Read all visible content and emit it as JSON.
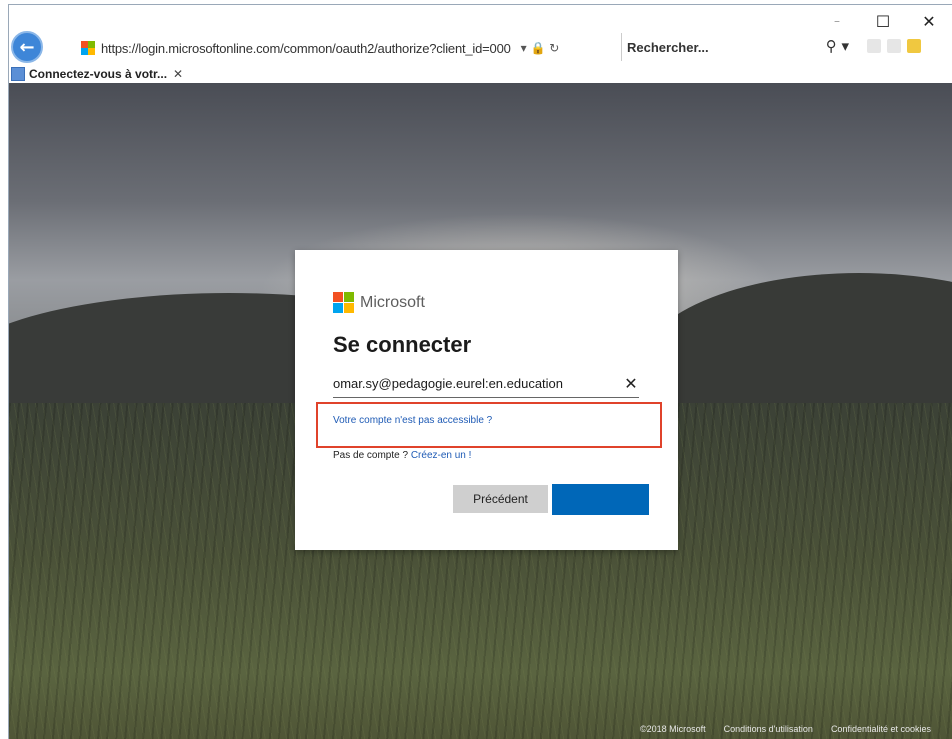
{
  "window": {
    "minimize_glyph": "–",
    "maximize_glyph": "☐",
    "close_glyph": "✕"
  },
  "browser": {
    "back_glyph": "←",
    "url": "https://login.microsoftonline.com/common/oauth2/authorize?client_id=000",
    "url_icons": "▾ 🔒 ↻",
    "search_placeholder": "Rechercher...",
    "search_glyph": "⚲ ▾",
    "tab_label": "Connectez-vous à votr...",
    "tab_close": "✕"
  },
  "signin": {
    "brand": "Microsoft",
    "title": "Se connecter",
    "email": "omar.sy@pedagogie.eurel:en.education",
    "clear_glyph": "✕",
    "account_link": "Votre compte n'est pas accessible ?",
    "no_account_text": "Pas de compte ? ",
    "create_link": "Créez-en un !",
    "back_button": "Précédent",
    "next_button": ""
  },
  "footer": {
    "copyright": "©2018 Microsoft",
    "terms": "Conditions d'utilisation",
    "privacy": "Confidentialité et cookies"
  },
  "colors": {
    "accent": "#0067b8",
    "link": "#1f5bb5",
    "highlight_border": "#e0432b"
  }
}
